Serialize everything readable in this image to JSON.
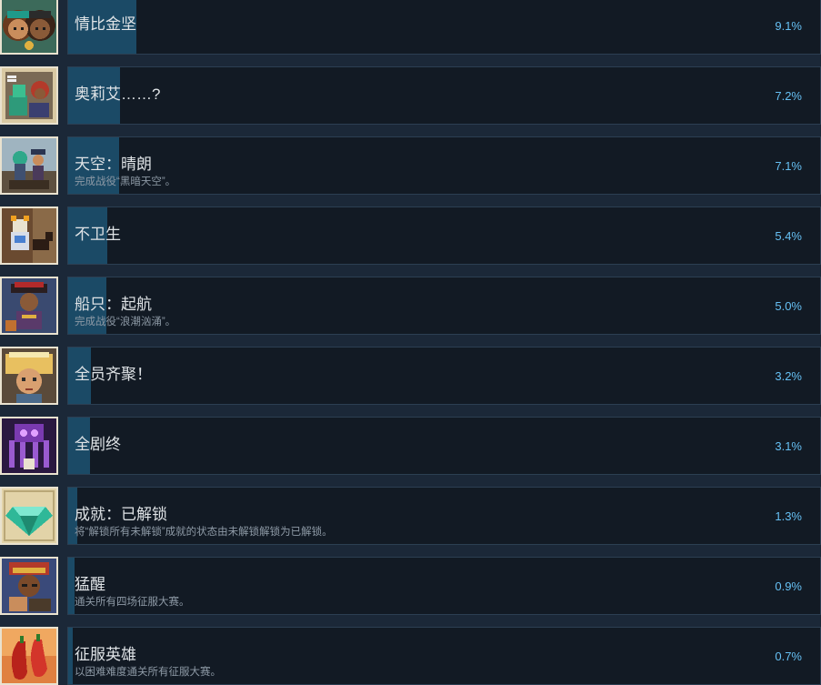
{
  "achievements": [
    {
      "title": "情比金坚",
      "description": "",
      "percent": "9.1%",
      "fill": 0.091,
      "icon": "couple-portrait-icon"
    },
    {
      "title": "奥莉艾……?",
      "description": "",
      "percent": "7.2%",
      "fill": 0.072,
      "icon": "scroll-characters-icon"
    },
    {
      "title": "天空：晴朗",
      "description": "完成战役“黑暗天空”。",
      "percent": "7.1%",
      "fill": 0.071,
      "icon": "sky-characters-icon"
    },
    {
      "title": "不卫生",
      "description": "",
      "percent": "5.4%",
      "fill": 0.054,
      "icon": "knight-and-dog-icon"
    },
    {
      "title": "船只：起航",
      "description": "完成战役“浪潮汹涌”。",
      "percent": "5.0%",
      "fill": 0.05,
      "icon": "pirate-captain-icon"
    },
    {
      "title": "全员齐聚！",
      "description": "",
      "percent": "3.2%",
      "fill": 0.032,
      "icon": "blonde-hero-icon"
    },
    {
      "title": "全剧终",
      "description": "",
      "percent": "3.1%",
      "fill": 0.031,
      "icon": "purple-tentacle-icon"
    },
    {
      "title": "成就：已解锁",
      "description": "将“解锁所有未解锁”成就的状态由未解锁解锁为已解锁。",
      "percent": "1.3%",
      "fill": 0.013,
      "icon": "gem-icon"
    },
    {
      "title": "猛醒",
      "description": "通关所有四场征服大赛。",
      "percent": "0.9%",
      "fill": 0.009,
      "icon": "warrior-portrait-icon"
    },
    {
      "title": "征服英雄",
      "description": "以困难难度通关所有征服大赛。",
      "percent": "0.7%",
      "fill": 0.007,
      "icon": "chili-peppers-icon"
    }
  ]
}
